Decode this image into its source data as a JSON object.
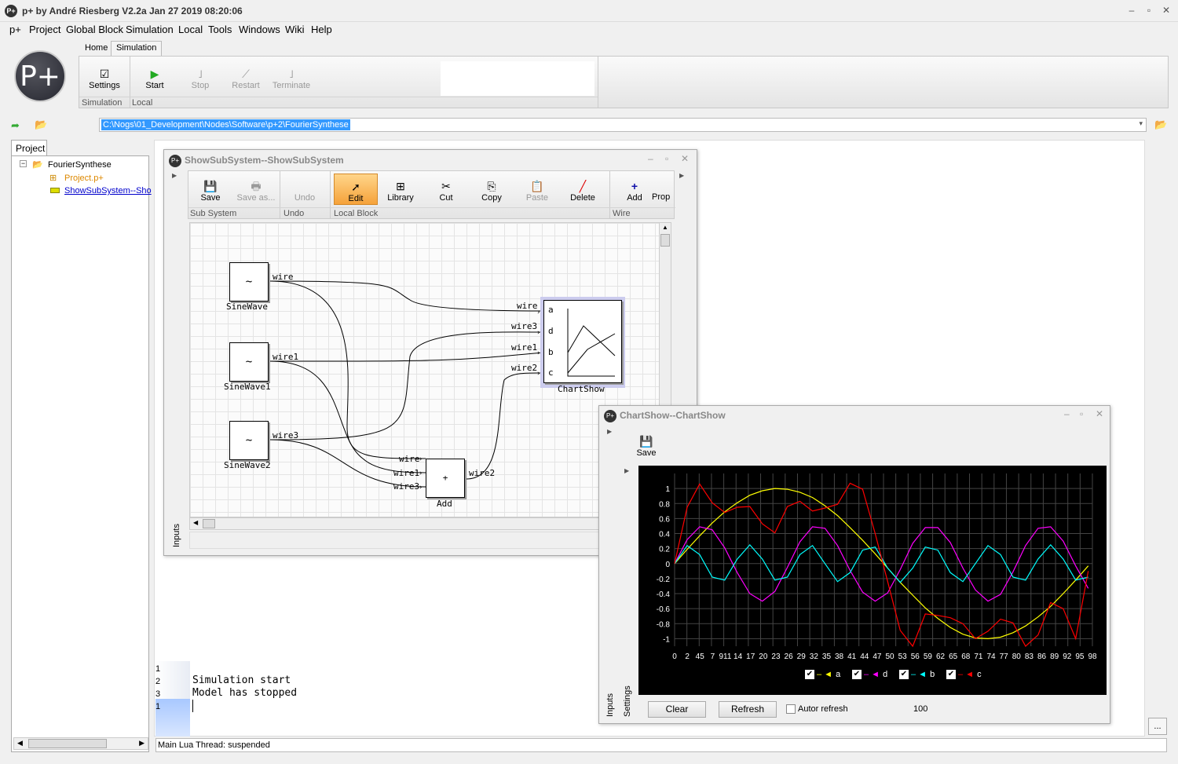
{
  "app": {
    "title": "p+ by André Riesberg  V2.2a Jan 27 2019 08:20:06",
    "icon": "P+",
    "logo": "P+"
  },
  "menu": [
    "p+",
    "Project",
    "Global Block",
    "Simulation",
    "Local",
    "Tools",
    "Windows",
    "Wiki",
    "Help"
  ],
  "ribbon": {
    "tabs": [
      "Home",
      "Simulation"
    ],
    "settings": "Settings",
    "start": "Start",
    "stop": "Stop",
    "restart": "Restart",
    "terminate": "Terminate",
    "group_simulation": "Simulation",
    "group_local": "Local"
  },
  "path": "C:\\Nogs\\01_Development\\Nodes\\Software\\p+2\\FourierSynthese",
  "project": {
    "tab": "Project",
    "root": "FourierSynthese",
    "items": [
      "Project.p+",
      "ShowSubSystem--Sho"
    ]
  },
  "subsystem": {
    "title": "ShowSubSystem--ShowSubSystem",
    "icon": "P+",
    "toolbar": {
      "save": "Save",
      "save_as": "Save as...",
      "undo": "Undo",
      "edit": "Edit",
      "library": "Library",
      "cut": "Cut",
      "copy": "Copy",
      "paste": "Paste",
      "delete": "Delete",
      "add": "Add",
      "prop": "Prop"
    },
    "groups": {
      "sub_system": "Sub System",
      "undo": "Undo",
      "local_block": "Local Block",
      "wire": "Wire"
    },
    "blocks": {
      "sine1": "SineWave",
      "sine2": "SineWave1",
      "sine3": "SineWave2",
      "add": "Add",
      "chart": "ChartShow",
      "sine_symbol": "~",
      "add_symbol": "+"
    },
    "wires": {
      "w0": "wire",
      "w1": "wire1",
      "w3": "wire3",
      "w2": "wire2"
    },
    "ports": [
      "a",
      "d",
      "b",
      "c"
    ],
    "side_tab": "Inputs"
  },
  "console": {
    "line_numbers": [
      "1",
      "2",
      "3",
      "1"
    ],
    "lines": [
      "",
      "Simulation start",
      "Model has stopped",
      ""
    ]
  },
  "status": "Main Lua Thread: suspended",
  "ellipsis": "...",
  "chartshow": {
    "title": "ChartShow--ChartShow",
    "icon": "P+",
    "save": "Save",
    "clear": "Clear",
    "refresh": "Refresh",
    "autorefresh": "Autor refresh",
    "value": "100",
    "side_tabs": [
      "Inputs",
      "Settings"
    ],
    "legend": [
      {
        "name": "a",
        "color": "#ffff00"
      },
      {
        "name": "d",
        "color": "#ff00ff"
      },
      {
        "name": "b",
        "color": "#00ffff"
      },
      {
        "name": "c",
        "color": "#ff0000"
      }
    ],
    "legend_prefix": "– ◄"
  },
  "chart_data": {
    "type": "line",
    "x": [
      0,
      3,
      6,
      9,
      12,
      15,
      18,
      21,
      24,
      27,
      30,
      33,
      36,
      39,
      42,
      45,
      48,
      51,
      54,
      57,
      60,
      63,
      66,
      69,
      72,
      75,
      78,
      81,
      84,
      87,
      90,
      93,
      96,
      99
    ],
    "xticks": [
      "0",
      "2",
      "45",
      "7",
      "911",
      "14",
      "17",
      "20",
      "23",
      "26",
      "29",
      "32",
      "35",
      "38",
      "41",
      "44",
      "47",
      "50",
      "53",
      "56",
      "59",
      "62",
      "65",
      "68",
      "71",
      "74",
      "77",
      "80",
      "83",
      "86",
      "89",
      "92",
      "95",
      "98"
    ],
    "yticks": [
      "1",
      "0.8",
      "0.6",
      "0.4",
      "0.2",
      "0",
      "-0.2",
      "-0.4",
      "-0.6",
      "-0.8",
      "-1"
    ],
    "ylim": [
      -1.1,
      1.2
    ],
    "xlim": [
      0,
      100
    ],
    "series": [
      {
        "name": "a",
        "color": "#ffff00",
        "values": [
          0.0,
          0.19,
          0.37,
          0.54,
          0.69,
          0.81,
          0.91,
          0.97,
          1.0,
          0.99,
          0.95,
          0.88,
          0.77,
          0.64,
          0.48,
          0.31,
          0.13,
          -0.06,
          -0.25,
          -0.42,
          -0.59,
          -0.73,
          -0.85,
          -0.94,
          -0.99,
          -1.0,
          -0.98,
          -0.92,
          -0.83,
          -0.71,
          -0.57,
          -0.4,
          -0.22,
          -0.03
        ]
      },
      {
        "name": "d",
        "color": "#ff00ff",
        "values": [
          0.0,
          0.32,
          0.49,
          0.45,
          0.21,
          -0.12,
          -0.4,
          -0.5,
          -0.37,
          -0.05,
          0.29,
          0.49,
          0.47,
          0.24,
          -0.09,
          -0.38,
          -0.5,
          -0.39,
          -0.08,
          0.27,
          0.48,
          0.48,
          0.28,
          -0.06,
          -0.35,
          -0.5,
          -0.41,
          -0.11,
          0.24,
          0.47,
          0.49,
          0.3,
          -0.03,
          -0.33
        ]
      },
      {
        "name": "b",
        "color": "#00ffff",
        "values": [
          0.0,
          0.24,
          0.12,
          -0.18,
          -0.22,
          0.06,
          0.25,
          0.06,
          -0.22,
          -0.18,
          0.12,
          0.24,
          0.0,
          -0.24,
          -0.12,
          0.18,
          0.22,
          -0.06,
          -0.25,
          -0.06,
          0.22,
          0.18,
          -0.12,
          -0.24,
          0.0,
          0.24,
          0.12,
          -0.18,
          -0.22,
          0.06,
          0.25,
          0.06,
          -0.22,
          -0.18
        ]
      },
      {
        "name": "c",
        "color": "#ff0000",
        "values": [
          0.0,
          0.75,
          1.06,
          0.81,
          0.68,
          0.75,
          0.76,
          0.53,
          0.41,
          0.76,
          0.83,
          0.7,
          0.74,
          0.79,
          1.07,
          0.99,
          0.4,
          -0.24,
          -0.89,
          -1.1,
          -0.67,
          -0.69,
          -0.72,
          -0.8,
          -1.0,
          -0.9,
          -0.74,
          -0.79,
          -1.1,
          -0.95,
          -0.52,
          -0.6,
          -1.0,
          -0.1
        ]
      }
    ]
  }
}
